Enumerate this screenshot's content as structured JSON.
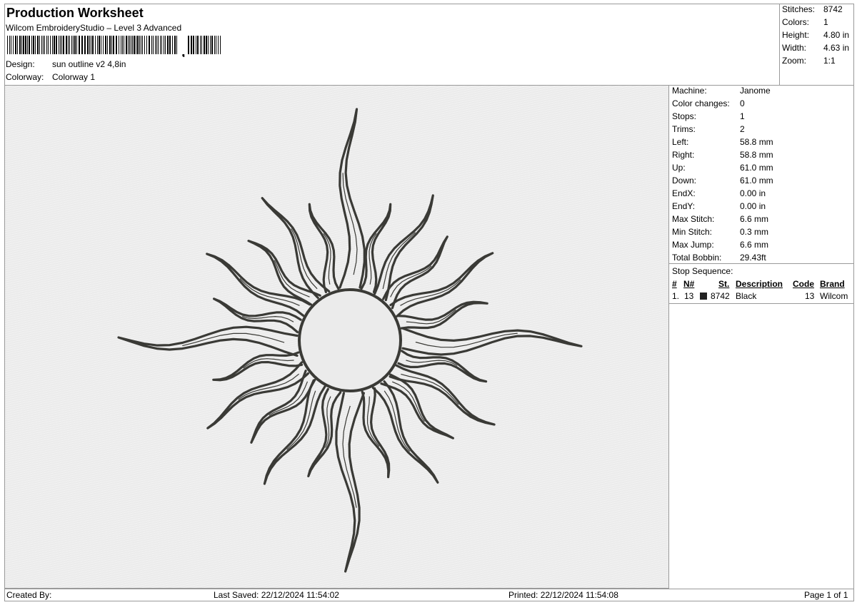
{
  "header": {
    "title": "Production Worksheet",
    "software": "Wilcom EmbroideryStudio – Level 3 Advanced",
    "design_label": "Design:",
    "design_value": "sun outline v2 4,8in",
    "colorway_label": "Colorway:",
    "colorway_value": "Colorway 1"
  },
  "summary": [
    {
      "label": "Stitches:",
      "value": "8742"
    },
    {
      "label": "Colors:",
      "value": "1"
    },
    {
      "label": "Height:",
      "value": "4.80 in"
    },
    {
      "label": "Width:",
      "value": "4.63 in"
    },
    {
      "label": "Zoom:",
      "value": "1:1"
    }
  ],
  "details": [
    {
      "label": "Machine:",
      "value": "Janome"
    },
    {
      "label": "Color changes:",
      "value": "0"
    },
    {
      "label": "Stops:",
      "value": "1"
    },
    {
      "label": "Trims:",
      "value": "2"
    },
    {
      "label": "Left:",
      "value": "58.8 mm"
    },
    {
      "label": "Right:",
      "value": "58.8 mm"
    },
    {
      "label": "Up:",
      "value": "61.0 mm"
    },
    {
      "label": "Down:",
      "value": "61.0 mm"
    },
    {
      "label": "EndX:",
      "value": "0.00 in"
    },
    {
      "label": "EndY:",
      "value": "0.00 in"
    },
    {
      "label": "Max Stitch:",
      "value": "6.6 mm"
    },
    {
      "label": "Min Stitch:",
      "value": "0.3 mm"
    },
    {
      "label": "Max Jump:",
      "value": "6.6 mm"
    },
    {
      "label": "Total Bobbin:",
      "value": "29.43ft"
    }
  ],
  "stop_sequence": {
    "title": "Stop Sequence:",
    "columns": {
      "num": "#",
      "n": "N#",
      "st": "St.",
      "desc": "Description",
      "code": "Code",
      "brand": "Brand"
    },
    "rows": [
      {
        "num": "1.",
        "n": "13",
        "st": "8742",
        "desc": "Black",
        "code": "13",
        "brand": "Wilcom",
        "color": "#222222"
      }
    ]
  },
  "footer": {
    "created_by": "Created By:",
    "last_saved": "Last Saved: 22/12/2024 11:54:02",
    "printed": "Printed: 22/12/2024 11:54:08",
    "page": "Page 1 of 1"
  },
  "design_colors": {
    "thread": "#3a3a36",
    "fabric": "#ebebeb"
  }
}
